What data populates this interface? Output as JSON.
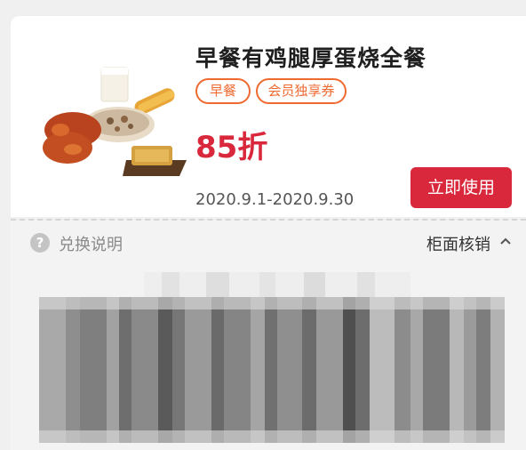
{
  "coupon": {
    "title": "早餐有鸡腿厚蛋烧全餐",
    "tags": [
      "早餐",
      "会员独享券"
    ],
    "discount": "85折",
    "use_button": "立即使用",
    "valid_dates": "2020.9.1-2020.9.30"
  },
  "redeem": {
    "help_label": "兑换说明",
    "verify_label": "柜面核销"
  },
  "colors": {
    "accent_red": "#d9283b",
    "tag_orange": "#ef6a30"
  },
  "icons": {
    "help": "question-circle-icon",
    "chevron": "chevron-up-icon"
  }
}
